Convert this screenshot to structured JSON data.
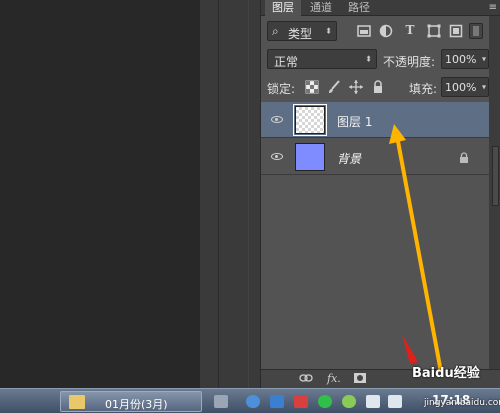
{
  "tabs": [
    "图层",
    "通道",
    "路径"
  ],
  "panel_menu": "≡",
  "filter": {
    "icon": "⌕",
    "label": "类型",
    "arrow": "⬍"
  },
  "filter_icons": [
    "image-filter-icon",
    "adjustment-filter-icon",
    "type-filter-icon",
    "shape-filter-icon",
    "smart-object-filter-icon"
  ],
  "blend_mode": {
    "value": "正常",
    "arrow": "⬍"
  },
  "opacity": {
    "label": "不透明度:",
    "value": "100%",
    "arrow": "▾"
  },
  "lock": {
    "label": "锁定:"
  },
  "fill": {
    "label": "填充:",
    "value": "100%",
    "arrow": "▾"
  },
  "layers": [
    {
      "name": "图层 1",
      "selected": true,
      "thumb": "transparent",
      "locked": false
    },
    {
      "name": "背景",
      "selected": false,
      "thumb": "#7f8cff",
      "locked": true
    }
  ],
  "bottom_icons": [
    "link-icon",
    "fx-icon",
    "mask-icon"
  ],
  "bottom_fx": "fx.",
  "taskbar": {
    "task_label": "01月份(3月)",
    "clock": "17:18"
  },
  "watermark": {
    "text": "Baidu经验",
    "sub": "jingyan.baidu.com"
  },
  "colors": {
    "selected_row": "#5e6e84",
    "background_layer": "#7f8cff",
    "arrow": "#ffb400"
  }
}
